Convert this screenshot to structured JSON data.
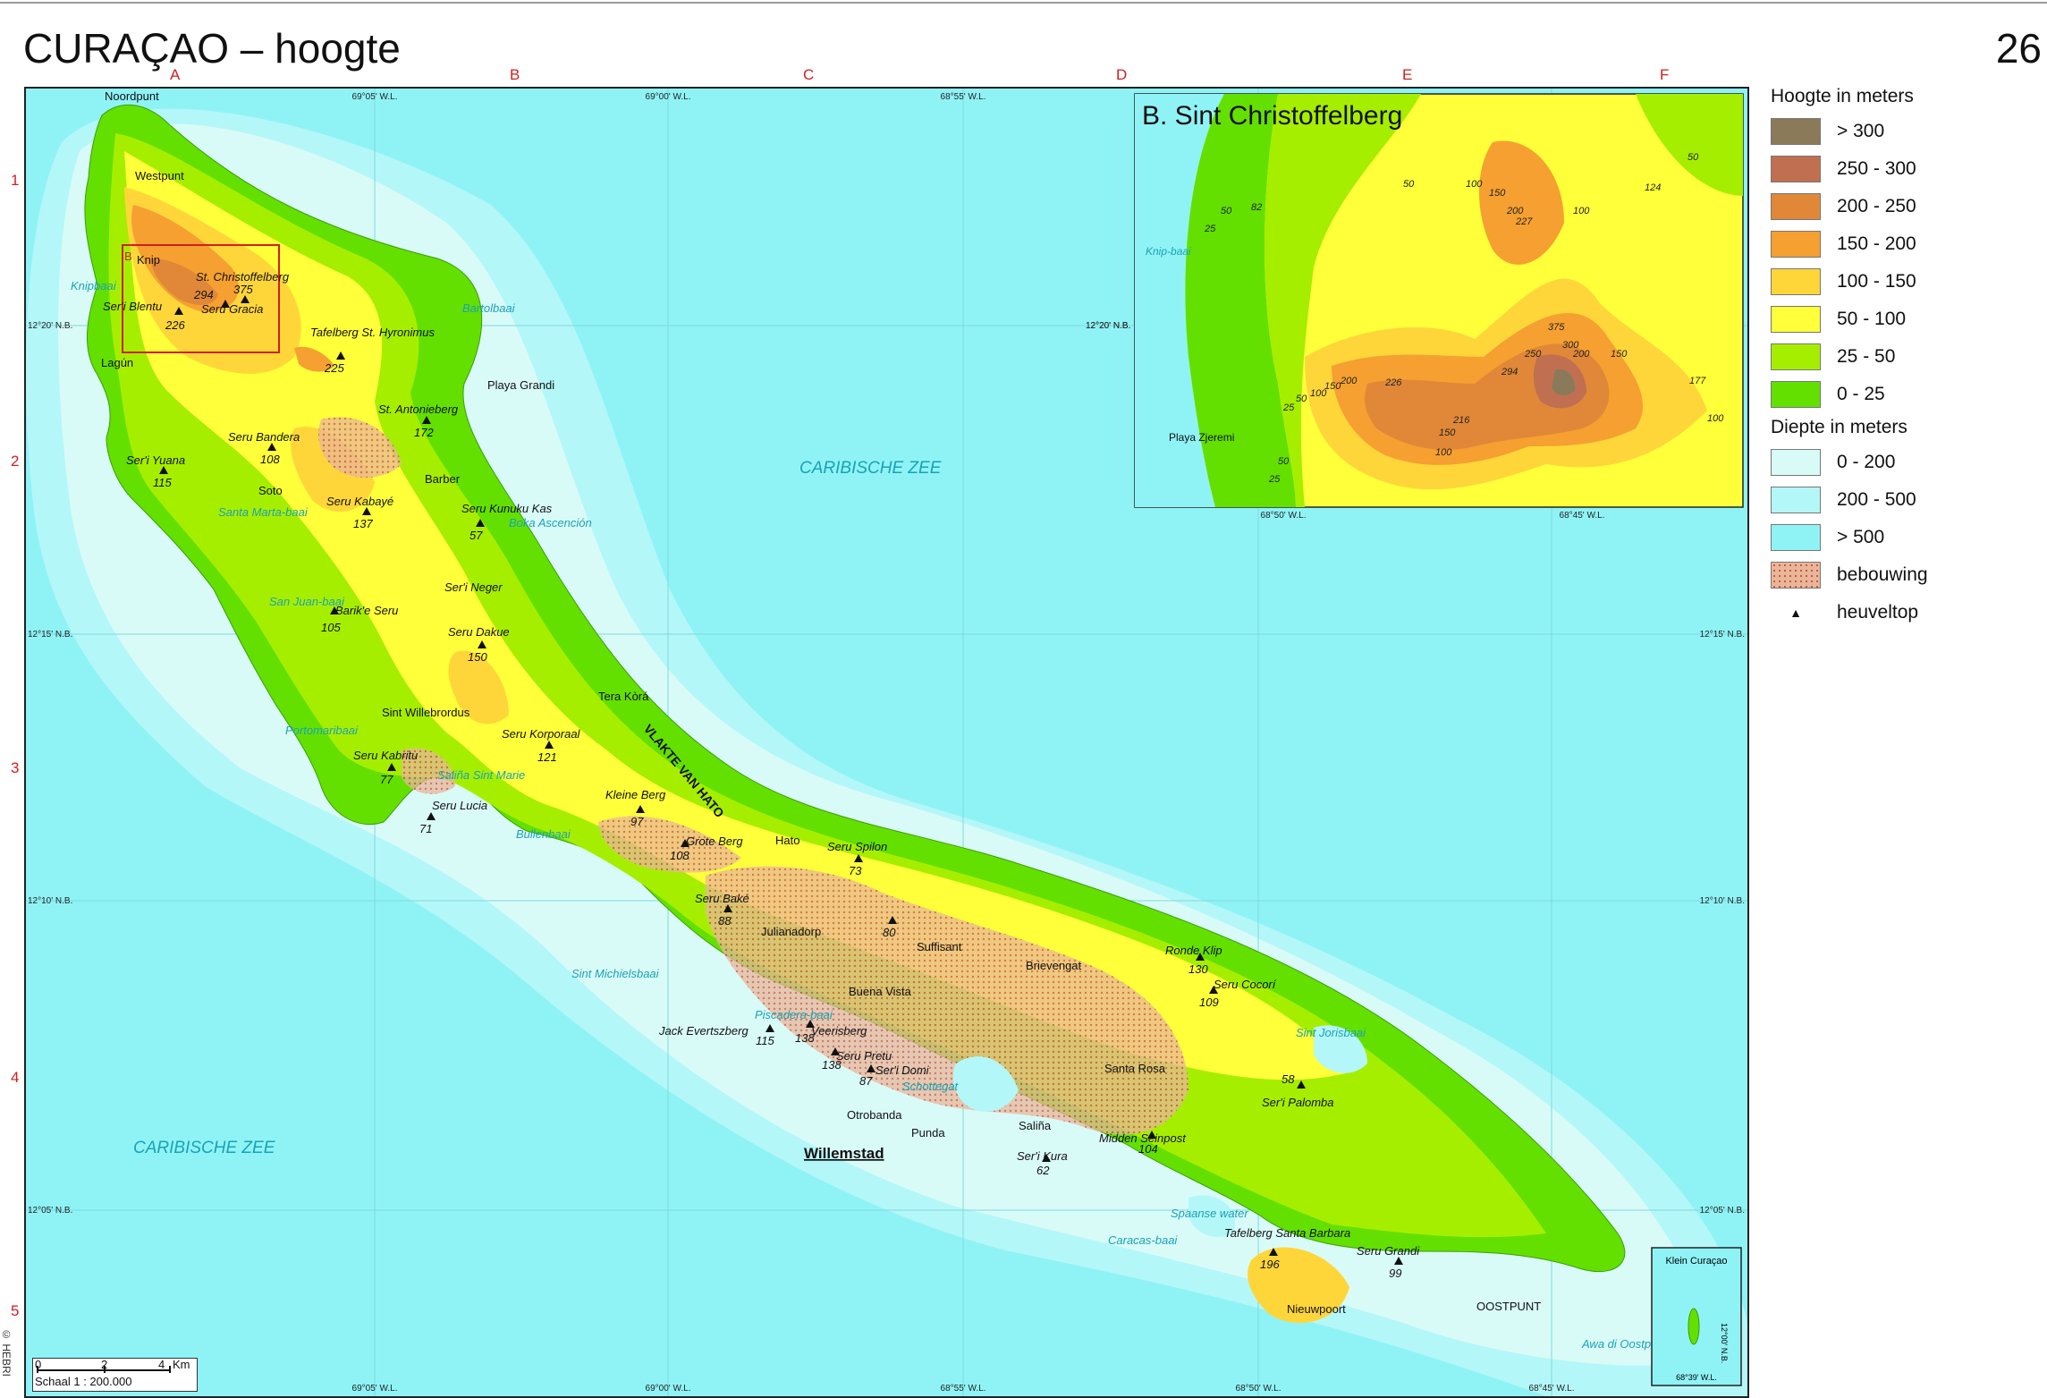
{
  "page": {
    "title": "CURAÇAO – hoogte",
    "page_number": "26",
    "copyright": "© HEBRI",
    "column_letters": [
      "A",
      "B",
      "C",
      "D",
      "E",
      "F"
    ],
    "row_numbers": [
      "1",
      "2",
      "3",
      "4",
      "5"
    ]
  },
  "colors": {
    "sea_deep": "#8ff3f6",
    "sea_mid": "#b4f7f8",
    "sea_shallow": "#d9fbf8",
    "elev_0_25": "#63e000",
    "elev_25_50": "#a6ee00",
    "elev_50_100": "#ffff3a",
    "elev_100_150": "#ffd63a",
    "elev_150_200": "#f5a030",
    "elev_200_250": "#e08838",
    "elev_250_300": "#c07050",
    "elev_over_300": "#8a7a5a",
    "built_up": "#e7b79a",
    "grid_red": "#d21f1f",
    "water_label": "#1aa2b5"
  },
  "map": {
    "coordinates_top": [
      "69°05' W.L.",
      "69°00' W.L.",
      "68°55' W.L."
    ],
    "coordinates_bottom": [
      "69°05' W.L.",
      "69°00' W.L.",
      "68°55' W.L.",
      "68°50' W.L.",
      "68°45' W.L."
    ],
    "coordinates_left": [
      "12°20' N.B.",
      "12°15' N.B.",
      "12°10' N.B.",
      "12°05' N.B."
    ],
    "coordinates_mid": [
      "12°20' N.B."
    ],
    "coordinates_right": [
      "12°15' N.B.",
      "12°10' N.B.",
      "12°05' N.B."
    ],
    "inset_marker": "B",
    "sea_labels": [
      "CARIBISCHE ZEE",
      "CARIBISCHE ZEE"
    ],
    "water_labels": [
      "Knipbaai",
      "Bartolbaai",
      "Santa Marta-baai",
      "San Juan-baai",
      "Boka Ascención",
      "Portomaribaai",
      "Saliña Sint Marie",
      "Bullenbaai",
      "Sint Michielsbaai",
      "Piscadera-baai",
      "Schottegat",
      "Spaanse water",
      "Caracas-baai",
      "Sint Jorisbaai",
      "Awa di Oostpunt"
    ],
    "place_labels": [
      "Noordpunt",
      "Westpunt",
      "Knip",
      "Lagún",
      "Playa Grandi",
      "Barber",
      "Soto",
      "Sint Willebrordus",
      "Tera Kòrá",
      "Hato",
      "Julianadorp",
      "Suffisant",
      "Brievengat",
      "Buena Vista",
      "Santa Rosa",
      "Otrobanda",
      "Punda",
      "Saliña",
      "Nieuwpoort",
      "OOSTPUNT"
    ],
    "capital_label": "Willemstad",
    "region_label": "VLAKTE VAN HATO",
    "peaks": [
      {
        "name": "St. Christoffelberg",
        "height": "375"
      },
      {
        "name": "",
        "height": "294"
      },
      {
        "name": "Ser'i Blentu",
        "height": "226"
      },
      {
        "name": "Seru Gracia",
        "height": ""
      },
      {
        "name": "Tafelberg St. Hyronimus",
        "height": "225"
      },
      {
        "name": "St. Antonieberg",
        "height": "172"
      },
      {
        "name": "Seru Bandera",
        "height": "108"
      },
      {
        "name": "Ser'i Yuana",
        "height": "115"
      },
      {
        "name": "Seru Kabayé",
        "height": "137"
      },
      {
        "name": "Seru Kunuku Kas",
        "height": "57"
      },
      {
        "name": "Ser'i Neger",
        "height": ""
      },
      {
        "name": "Barik'e Seru",
        "height": "105"
      },
      {
        "name": "Seru Dakue",
        "height": "150"
      },
      {
        "name": "Seru Korporaal",
        "height": "121"
      },
      {
        "name": "Seru Kabritu",
        "height": "77"
      },
      {
        "name": "Seru Lucia",
        "height": "71"
      },
      {
        "name": "Kleine Berg",
        "height": "97"
      },
      {
        "name": "Grote Berg",
        "height": "108"
      },
      {
        "name": "Seru Spilon",
        "height": "73"
      },
      {
        "name": "Seru Baké",
        "height": "88"
      },
      {
        "name": "",
        "height": "80"
      },
      {
        "name": "Jack Evertszberg",
        "height": "115"
      },
      {
        "name": "Veerisberg",
        "height": "138"
      },
      {
        "name": "Seru Pretu",
        "height": "138"
      },
      {
        "name": "Ser'i Domi",
        "height": "87"
      },
      {
        "name": "Ronde Klip",
        "height": "130"
      },
      {
        "name": "Seru Cocorí",
        "height": "109"
      },
      {
        "name": "",
        "height": "58"
      },
      {
        "name": "Ser'i Palomba",
        "height": ""
      },
      {
        "name": "Midden Seinpost",
        "height": "104"
      },
      {
        "name": "Ser'i Kura",
        "height": "62"
      },
      {
        "name": "Tafelberg Santa Barbara",
        "height": "196"
      },
      {
        "name": "Seru Grandi",
        "height": "99"
      }
    ],
    "scale_ticks": [
      "0",
      "2",
      "4",
      "Km"
    ],
    "scale_text": "Schaal 1 : 200.000",
    "klein_curacao_label": "Klein Curaçao",
    "klein_curacao_lat": "12°00' N.B.",
    "klein_curacao_lon": "68°39' W.L."
  },
  "inset": {
    "title": "B. Sint Christoffelberg",
    "bay_label": "Knip-baai",
    "place_label": "Playa Zjeremi",
    "coord_left": "12°20' N.B.",
    "coords_bottom": [
      "68°50' W.L.",
      "68°45' W.L."
    ],
    "contour_labels": [
      "25",
      "50",
      "82",
      "50",
      "100",
      "150",
      "200",
      "227",
      "100",
      "124",
      "50",
      "25",
      "50",
      "100",
      "150",
      "226",
      "200",
      "216",
      "150",
      "100",
      "294",
      "250",
      "375",
      "300",
      "200",
      "150",
      "177",
      "100",
      "50",
      "25"
    ]
  },
  "legend": {
    "height_heading": "Hoogte in meters",
    "height_items": [
      {
        "label": "> 300",
        "color": "#8a7a5a"
      },
      {
        "label": "250 - 300",
        "color": "#c07050"
      },
      {
        "label": "200 - 250",
        "color": "#e08838"
      },
      {
        "label": "150 - 200",
        "color": "#f5a030"
      },
      {
        "label": "100 - 150",
        "color": "#ffd63a"
      },
      {
        "label": "50 - 100",
        "color": "#ffff3a"
      },
      {
        "label": "25 - 50",
        "color": "#a6ee00"
      },
      {
        "label": "0 - 25",
        "color": "#63e000"
      }
    ],
    "depth_heading": "Diepte in meters",
    "depth_items": [
      {
        "label": "0 - 200",
        "color": "#d9fbf8"
      },
      {
        "label": "200 - 500",
        "color": "#b4f7f8"
      },
      {
        "label": "> 500",
        "color": "#8ff3f6"
      }
    ],
    "built_label": "bebouwing",
    "peak_label": "heuveltop"
  }
}
